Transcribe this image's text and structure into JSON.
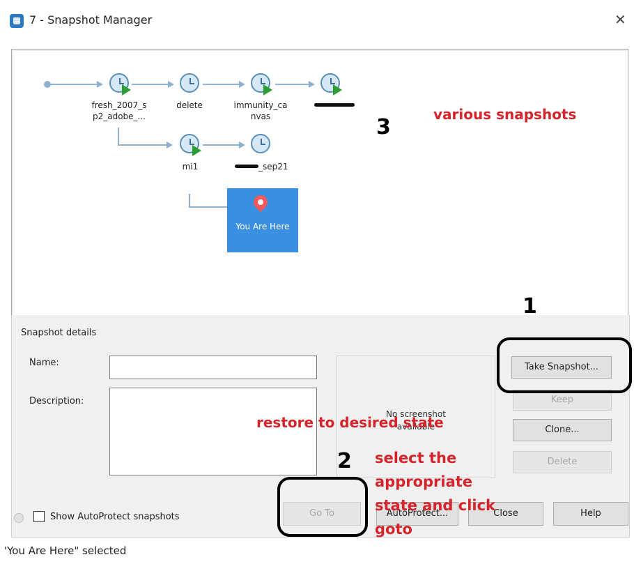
{
  "window": {
    "title": "7 - Snapshot Manager",
    "close_symbol": "✕"
  },
  "tree": {
    "nodes": [
      {
        "label": "fresh_2007_s\np2_adobe_..."
      },
      {
        "label": "delete"
      },
      {
        "label": "immunity_ca\nnvas"
      },
      {
        "label": ""
      },
      {
        "label": "mi1"
      },
      {
        "label": "_sep21"
      }
    ],
    "current_label": "You Are Here"
  },
  "annotations": {
    "various": "various snapshots",
    "three": "3",
    "one": "1",
    "two": "2",
    "restore": "restore to desired state",
    "select": "select the\nappropriate\nstate and click\ngoto"
  },
  "details": {
    "group_title": "Snapshot details",
    "name_label": "Name:",
    "name_value": "",
    "description_label": "Description:",
    "description_value": "",
    "screenshot_text": "No screenshot\navailable"
  },
  "buttons": {
    "take_snapshot": "Take Snapshot...",
    "keep": "Keep",
    "clone": "Clone...",
    "delete": "Delete",
    "goto": "Go To",
    "autoprotect": "AutoProtect...",
    "close": "Close",
    "help": "Help"
  },
  "footer": {
    "show_autoprotect": "Show AutoProtect snapshots",
    "status": "'You Are Here\" selected"
  },
  "colors": {
    "current_bg": "#3a8fe0",
    "annotation_red": "#d3252b"
  }
}
